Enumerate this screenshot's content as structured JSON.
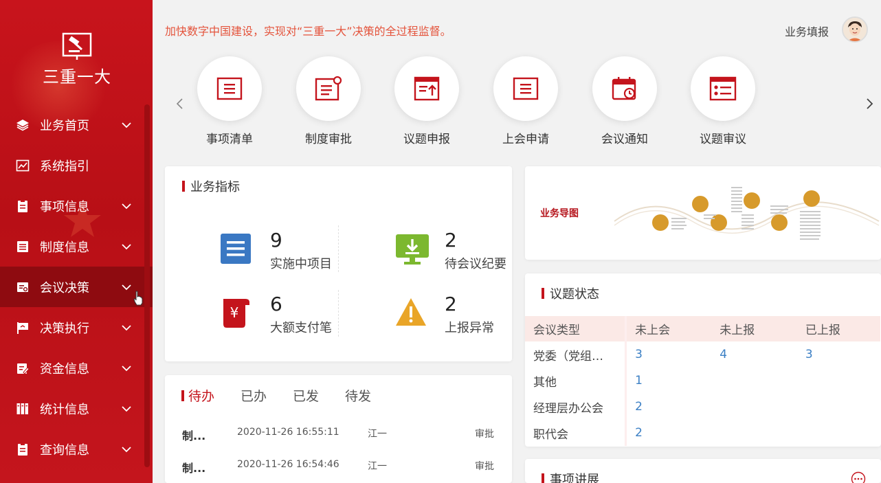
{
  "sidebar": {
    "logo_text": "三重一大",
    "items": [
      {
        "label": "业务首页",
        "has_arrow": true,
        "active": false
      },
      {
        "label": "系统指引",
        "has_arrow": false,
        "active": false
      },
      {
        "label": "事项信息",
        "has_arrow": true,
        "active": false
      },
      {
        "label": "制度信息",
        "has_arrow": true,
        "active": false
      },
      {
        "label": "会议决策",
        "has_arrow": true,
        "active": true
      },
      {
        "label": "决策执行",
        "has_arrow": true,
        "active": false
      },
      {
        "label": "资金信息",
        "has_arrow": true,
        "active": false
      },
      {
        "label": "统计信息",
        "has_arrow": true,
        "active": false
      },
      {
        "label": "查询信息",
        "has_arrow": true,
        "active": false
      }
    ]
  },
  "header": {
    "slogan": "加快数字中国建设，实现对“三重一大”决策的全过程监督。",
    "user_label": "业务填报"
  },
  "quick_nav": [
    {
      "label": "事项清单",
      "icon": "list-icon"
    },
    {
      "label": "制度审批",
      "icon": "document-badge-icon"
    },
    {
      "label": "议题申报",
      "icon": "upload-document-icon"
    },
    {
      "label": "上会申请",
      "icon": "list-icon"
    },
    {
      "label": "会议通知",
      "icon": "calendar-clock-icon"
    },
    {
      "label": "议题审议",
      "icon": "checklist-icon"
    }
  ],
  "metrics": {
    "title": "业务指标",
    "items": [
      {
        "value": "9",
        "label": "实施中项目",
        "icon": "list-box-icon",
        "color": "#3a78c3"
      },
      {
        "value": "2",
        "label": "待会议纪要",
        "icon": "monitor-download-icon",
        "color": "#7cb82f"
      },
      {
        "value": "6",
        "label": "大额支付笔",
        "icon": "yuan-scroll-icon",
        "color": "#c4141c"
      },
      {
        "value": "2",
        "label": "上报异常",
        "icon": "warning-icon",
        "color": "#e9a528"
      }
    ]
  },
  "business_map": {
    "title": "业务导图"
  },
  "todo": {
    "tabs": [
      "待办",
      "已办",
      "已发",
      "待发"
    ],
    "active_tab": 0,
    "rows": [
      {
        "title": "制...",
        "time": "2020-11-26 16:55:11",
        "user": "江一",
        "type": "审批"
      },
      {
        "title": "制...",
        "time": "2020-11-26 16:54:46",
        "user": "江一",
        "type": "审批"
      }
    ]
  },
  "status": {
    "title": "议题状态",
    "columns": [
      "会议类型",
      "未上会",
      "未上报",
      "已上报"
    ],
    "rows": [
      {
        "type": "党委（党组…",
        "c1": "3",
        "c2": "4",
        "c3": "3"
      },
      {
        "type": "其他",
        "c1": "1",
        "c2": "",
        "c3": ""
      },
      {
        "type": "经理层办公会",
        "c1": "2",
        "c2": "",
        "c3": ""
      },
      {
        "type": "职代会",
        "c1": "2",
        "c2": "",
        "c3": ""
      }
    ]
  },
  "progress": {
    "title": "事项讲展"
  }
}
